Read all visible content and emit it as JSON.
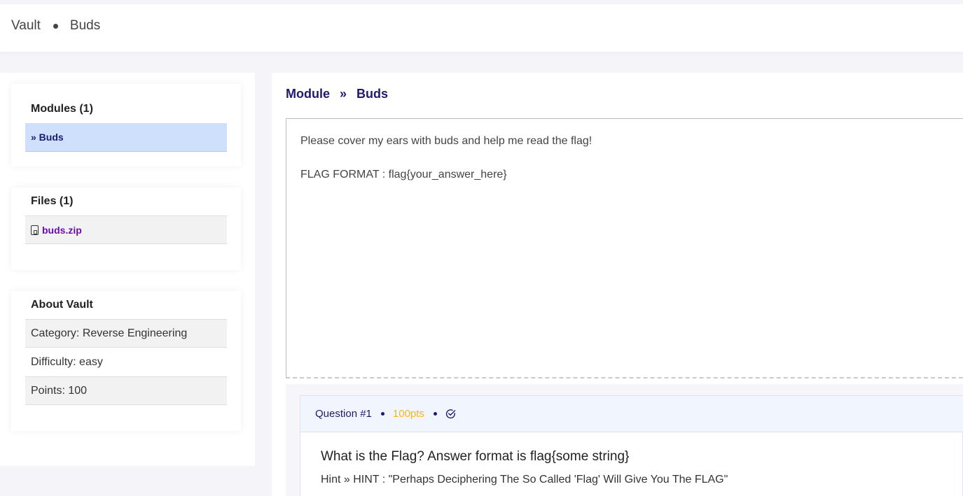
{
  "topbar": {
    "crumbs": [
      "Vault",
      "Buds"
    ]
  },
  "sidebar": {
    "modules": {
      "title": "Modules (1)",
      "items": [
        {
          "label": "» Buds",
          "active": true
        }
      ]
    },
    "files": {
      "title": "Files (1)",
      "items": [
        {
          "name": "buds.zip",
          "icon": "file-zip-icon"
        }
      ]
    },
    "about": {
      "title": "About Vault",
      "category": "Category: Reverse Engineering",
      "difficulty": "Difficulty: easy",
      "points": "Points: 100"
    }
  },
  "main": {
    "breadcrumb": {
      "first": "Module",
      "sep": "»",
      "second": "Buds"
    },
    "description": {
      "line1": "Please cover my ears with buds and help me read the flag!",
      "line2": "FLAG FORMAT : flag{your_answer_here}"
    },
    "question": {
      "number": "Question #1",
      "points": "100pts",
      "status_icon": "check-circle-icon",
      "text": "What is the Flag? Answer format is flag{some string}",
      "hint": "Hint » HINT : \"Perhaps Deciphering The So Called 'Flag' Will Give You The FLAG\""
    }
  },
  "colors": {
    "accent": "#1f1a6e",
    "active_row": "#cfe0fc",
    "points": "#f2b81c",
    "file_link": "#6a0dad"
  }
}
